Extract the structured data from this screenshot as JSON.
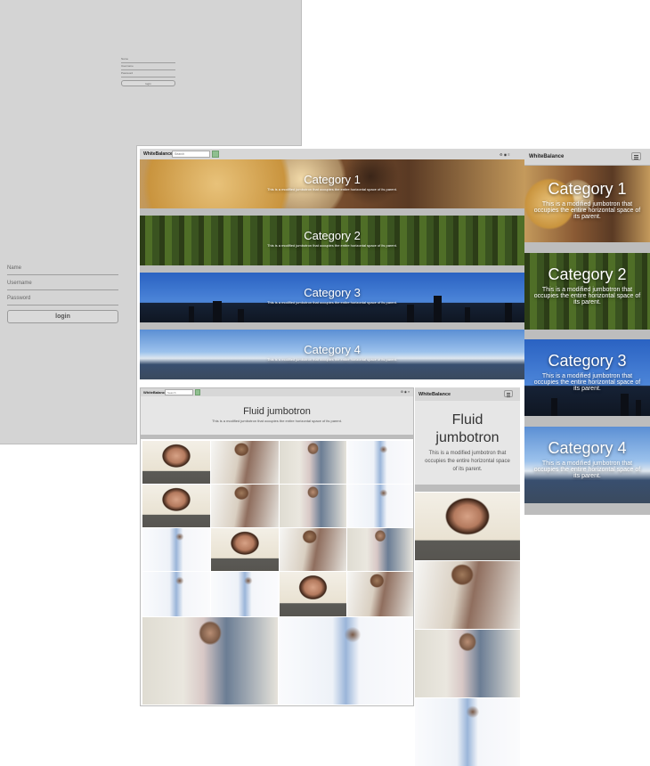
{
  "login": {
    "name_label": "Name",
    "username_label": "Username",
    "password_label": "Password",
    "button_label": "login"
  },
  "desktop": {
    "brand": "WhiteBalance",
    "search_placeholder": "Search",
    "categories": [
      {
        "title": "Category 1",
        "desc": "This is a modified jumbotron that occupies the entire horizontal space of its parent."
      },
      {
        "title": "Category 2",
        "desc": "This is a modified jumbotron that occupies the entire horizontal space of its parent."
      },
      {
        "title": "Category 3",
        "desc": "This is a modified jumbotron that occupies the entire horizontal space of its parent."
      },
      {
        "title": "Category 4",
        "desc": "This is a modified jumbotron that occupies the entire horizontal space of its parent."
      }
    ]
  },
  "mobile": {
    "brand": "WhiteBalance",
    "categories": [
      {
        "title": "Category 1",
        "desc": "This is a modified jumbotron that occupies the entire horizontal space of its parent."
      },
      {
        "title": "Category 2",
        "desc": "This is a modified jumbotron that occupies the entire horizontal space of its parent."
      },
      {
        "title": "Category 3",
        "desc": "This is a modified jumbotron that occupies the entire horizontal space of its parent."
      },
      {
        "title": "Category 4",
        "desc": "This is a modified jumbotron that occupies the entire horizontal space of its parent."
      }
    ]
  },
  "gallery_desktop": {
    "brand": "WhiteBalance",
    "search_placeholder": "Search",
    "jumbo_title": "Fluid jumbotron",
    "jumbo_desc": "This is a modified jumbotron that occupies the entire horizontal space of its parent."
  },
  "gallery_mobile": {
    "brand": "WhiteBalance",
    "jumbo_title": "Fluid jumbotron",
    "jumbo_desc": "This is a modified jumbotron that occupies the entire horizontal space of its parent."
  }
}
